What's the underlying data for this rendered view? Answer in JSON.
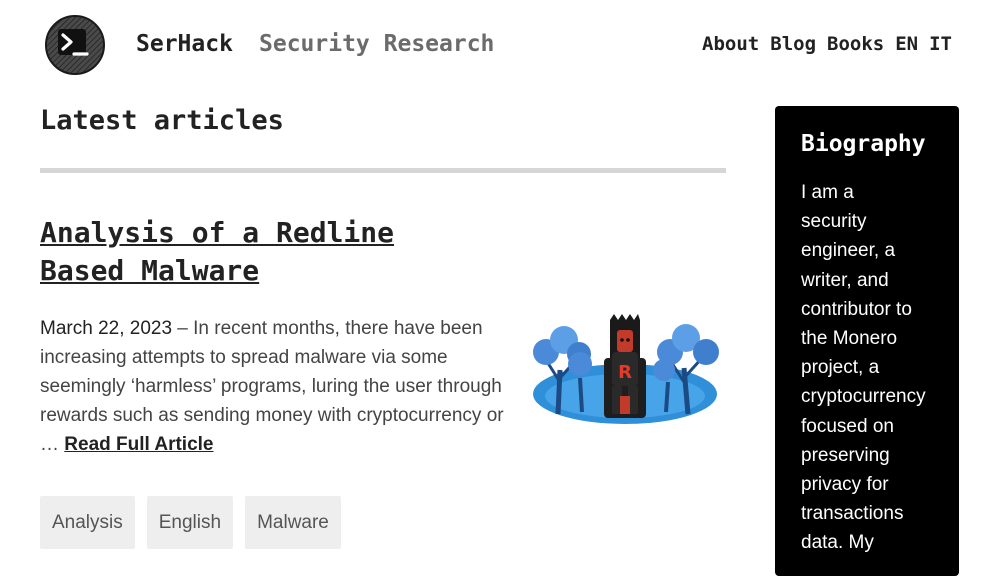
{
  "header": {
    "site_name": "SerHack",
    "tagline": "Security Research",
    "nav": [
      {
        "label": "About"
      },
      {
        "label": "Blog"
      },
      {
        "label": "Books"
      },
      {
        "label": "EN"
      },
      {
        "label": "IT"
      }
    ]
  },
  "main": {
    "section_title": "Latest articles",
    "article": {
      "title": "Analysis of a Redline Based Malware",
      "date": "March 22, 2023",
      "separator": " – ",
      "excerpt": "In recent months, there have been increasing attempts to spread malware via some seemingly ‘harmless’ programs, luring the user through rewards such as sending money with cryptocurrency or … ",
      "read_more": "Read Full Article",
      "illustration_letter": "R",
      "tags": [
        "Analysis",
        "English",
        "Malware"
      ]
    }
  },
  "sidebar": {
    "title": "Biography",
    "text": "I am a\nsecurity\nengineer, a\nwriter, and\ncontributor to\nthe Monero\nproject, a\ncryptocurrency\nfocused on\npreserving\nprivacy for\ntransactions\ndata. My"
  },
  "icons": {
    "logo": "terminal-prompt-icon"
  },
  "colors": {
    "tagline": "#6b6b6b",
    "sidebar_bg": "#000000",
    "tag_bg": "#eeeeee",
    "rule": "#d6d6d6",
    "illustration_blue": "#2f8fd8",
    "illustration_accent": "#e53a2a"
  }
}
